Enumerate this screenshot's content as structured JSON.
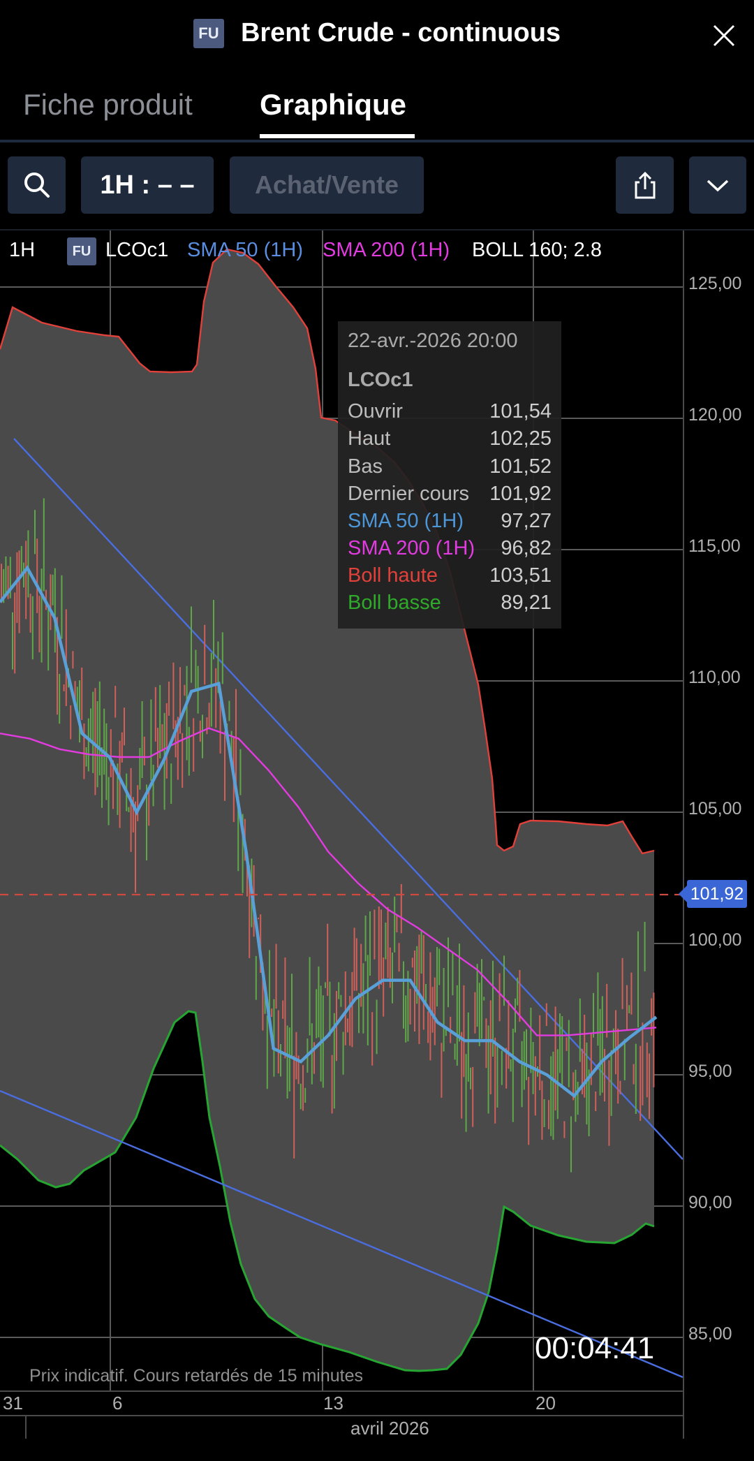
{
  "header": {
    "badge": "FU",
    "title": "Brent Crude - continuous"
  },
  "tabs": [
    {
      "label": "Fiche produit"
    },
    {
      "label": "Graphique"
    }
  ],
  "toolbar": {
    "interval_label": "1H : – –",
    "order_label": "Achat/Vente"
  },
  "legend": {
    "interval": "1H",
    "badge": "FU",
    "symbol": "LCOc1",
    "sma50": "SMA 50 (1H)",
    "sma200": "SMA 200 (1H)",
    "boll": "BOLL 160; 2.8"
  },
  "tooltip": {
    "date": "22-avr.-2026 20:00",
    "symbol": "LCOc1",
    "rows": [
      {
        "label": "Ouvrir",
        "value": "101,54"
      },
      {
        "label": "Haut",
        "value": "102,25"
      },
      {
        "label": "Bas",
        "value": "101,52"
      },
      {
        "label": "Dernier cours",
        "value": "101,92"
      },
      {
        "label": "SMA 50 (1H)",
        "value": "97,27"
      },
      {
        "label": "SMA 200 (1H)",
        "value": "96,82"
      },
      {
        "label": "Boll haute",
        "value": "103,51"
      },
      {
        "label": "Boll basse",
        "value": "89,21"
      }
    ]
  },
  "price_tag": "101,92",
  "timer": "00:04:41",
  "disclaimer": "Prix indicatif. Cours retardés de 15 minutes",
  "axis": {
    "y_ticks": [
      "125,00",
      "120,00",
      "115,00",
      "110,00",
      "105,00",
      "100,00",
      "95,00",
      "90,00",
      "85,00"
    ],
    "x_ticks": [
      "31",
      "6",
      "13",
      "20"
    ],
    "month": "avril 2026"
  },
  "colors": {
    "sma50": "#5aa0d8",
    "sma200": "#e23ce0",
    "boll_upper": "#e0413a",
    "boll_lower": "#27a532",
    "trend": "#4a6ee0",
    "band_fill": "#4a4a4a",
    "candle_up": "#5fa84a",
    "candle_down": "#d0605a",
    "price_line": "#d0493f"
  },
  "chart_data": {
    "type": "line",
    "symbol": "LCOc1",
    "ylim": [
      83,
      127
    ],
    "y_ticks": [
      85,
      90,
      95,
      100,
      105,
      110,
      115,
      120,
      125
    ],
    "x_ticks": [
      "31",
      "6",
      "13",
      "20"
    ],
    "last_price": 101.92,
    "series": [
      {
        "name": "SMA 50 (1H)",
        "values": [
          113.0,
          114.3,
          112.4,
          108.0,
          107.1,
          105.0,
          107.0,
          109.6,
          109.9,
          103.5,
          96.0,
          95.5,
          96.5,
          97.9,
          98.6,
          98.6,
          97.0,
          96.3,
          96.3,
          95.5,
          95.0,
          94.2,
          95.5,
          96.4,
          97.2
        ]
      },
      {
        "name": "SMA 200 (1H)",
        "values": [
          108.0,
          107.8,
          107.4,
          107.2,
          107.1,
          107.1,
          107.7,
          108.2,
          107.8,
          106.6,
          105.2,
          103.5,
          102.3,
          101.3,
          100.6,
          99.8,
          99.0,
          97.8,
          96.5,
          96.5,
          96.6,
          96.7,
          96.8
        ]
      }
    ]
  }
}
